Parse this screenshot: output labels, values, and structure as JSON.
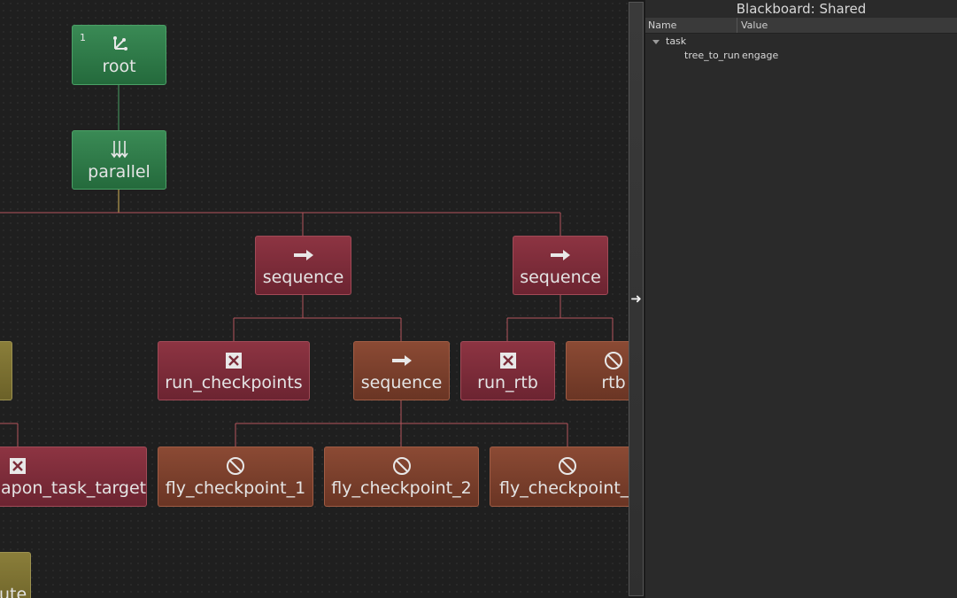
{
  "panel": {
    "title": "Blackboard: Shared",
    "columns": {
      "name": "Name",
      "value": "Value"
    },
    "rows": [
      {
        "key": "task",
        "value": ""
      },
      {
        "key": "tree_to_run",
        "value": "engage"
      }
    ]
  },
  "nodes": {
    "root": {
      "label": "root",
      "index": "1",
      "icon": "root-icon"
    },
    "parallel": {
      "label": "parallel",
      "icon": "parallel-icon"
    },
    "sequence_a": {
      "label": "sequence",
      "icon": "arrow-right-icon"
    },
    "sequence_b": {
      "label": "sequence",
      "icon": "arrow-right-icon"
    },
    "run_checkpoints": {
      "label": "run_checkpoints",
      "icon": "failure-x-icon"
    },
    "sequence_c": {
      "label": "sequence",
      "icon": "arrow-right-icon"
    },
    "run_rtb": {
      "label": "run_rtb",
      "icon": "failure-x-icon"
    },
    "rtb": {
      "label": "rtb",
      "icon": "invalid-circle-icon"
    },
    "weapon_task_target": {
      "label": "apon_task_target",
      "icon": "failure-x-icon"
    },
    "fly_checkpoint_1": {
      "label": "fly_checkpoint_1",
      "icon": "invalid-circle-icon"
    },
    "fly_checkpoint_2": {
      "label": "fly_checkpoint_2",
      "icon": "invalid-circle-icon"
    },
    "fly_checkpoint_3": {
      "label": "fly_checkpoint_",
      "icon": "invalid-circle-icon"
    },
    "bottom_left": {
      "label": "ute"
    }
  },
  "colors": {
    "success": "#2e7a48",
    "failure": "#7c2c39",
    "invalid": "#7a402c",
    "running": "#7b7030",
    "edge_red": "#b5545c",
    "edge_green": "#4aa066",
    "edge_yellow": "#d6b658"
  },
  "splitter": {
    "icon": "arrow-right-icon"
  }
}
